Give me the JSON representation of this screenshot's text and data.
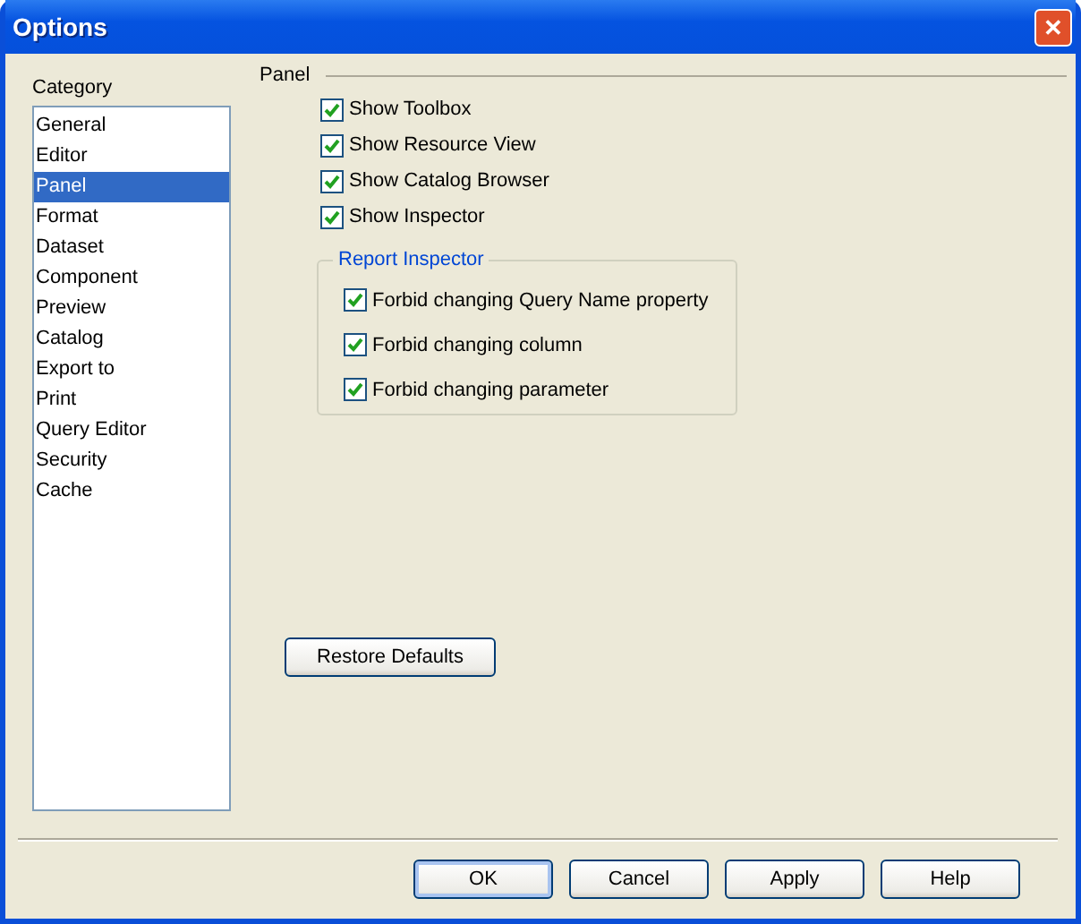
{
  "window": {
    "title": "Options",
    "close": "✕"
  },
  "category": {
    "label": "Category",
    "items": [
      {
        "label": "General",
        "selected": false
      },
      {
        "label": "Editor",
        "selected": false
      },
      {
        "label": "Panel",
        "selected": true
      },
      {
        "label": "Format",
        "selected": false
      },
      {
        "label": "Dataset",
        "selected": false
      },
      {
        "label": "Component",
        "selected": false
      },
      {
        "label": "Preview",
        "selected": false
      },
      {
        "label": "Catalog",
        "selected": false
      },
      {
        "label": "Export to",
        "selected": false
      },
      {
        "label": "Print",
        "selected": false
      },
      {
        "label": "Query Editor",
        "selected": false
      },
      {
        "label": "Security",
        "selected": false
      },
      {
        "label": "Cache",
        "selected": false
      }
    ]
  },
  "panel": {
    "title": "Panel",
    "options": [
      {
        "label": "Show Toolbox",
        "checked": true
      },
      {
        "label": "Show Resource View",
        "checked": true
      },
      {
        "label": "Show Catalog Browser",
        "checked": true
      },
      {
        "label": "Show Inspector",
        "checked": true
      }
    ],
    "group": {
      "title": "Report Inspector",
      "options": [
        {
          "label": "Forbid changing Query Name property",
          "checked": true
        },
        {
          "label": "Forbid changing column",
          "checked": true
        },
        {
          "label": "Forbid changing parameter",
          "checked": true
        }
      ]
    },
    "restore_button": "Restore Defaults"
  },
  "buttons": [
    {
      "label": "OK",
      "default": true
    },
    {
      "label": "Cancel",
      "default": false
    },
    {
      "label": "Apply",
      "default": false
    },
    {
      "label": "Help",
      "default": false
    }
  ]
}
